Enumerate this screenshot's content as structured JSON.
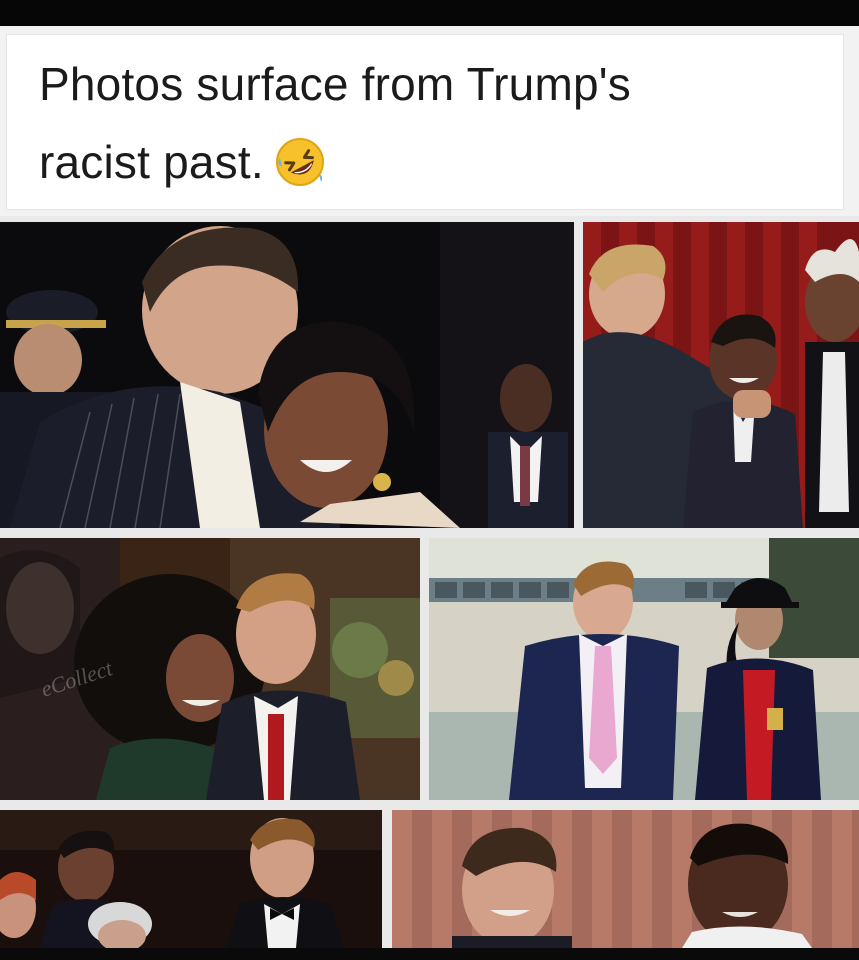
{
  "caption": {
    "line1": "Photos surface from Trump's",
    "line2": "racist past.",
    "emoji": "rolling-on-floor-laughing-emoji"
  },
  "photos": [
    {
      "id": "photo-1",
      "description_icon": "photo"
    },
    {
      "id": "photo-2",
      "description_icon": "photo"
    },
    {
      "id": "photo-3",
      "description_icon": "photo",
      "watermark": "eCollect"
    },
    {
      "id": "photo-4",
      "description_icon": "photo"
    },
    {
      "id": "photo-5",
      "description_icon": "photo"
    },
    {
      "id": "photo-6",
      "description_icon": "photo"
    }
  ],
  "colors": {
    "background": "#000000",
    "caption_bg": "#ffffff",
    "text": "#1b1b1b",
    "gutter": "#e9e9e9"
  }
}
